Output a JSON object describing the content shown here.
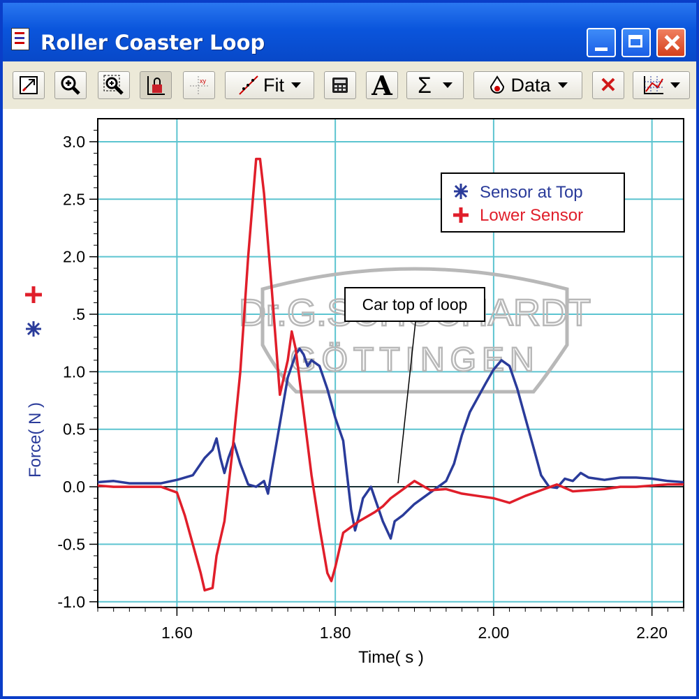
{
  "window": {
    "title": "Roller Coaster Loop"
  },
  "toolbar": {
    "fit_label": "Fit",
    "data_label": "Data",
    "text_tool_glyph": "A",
    "stats_glyph": "Σ",
    "delete_glyph": "✕"
  },
  "colors": {
    "series_top": "#2a3b9a",
    "series_lower": "#e01e2a",
    "grid": "#5cc4d0",
    "watermark": "#b8b8b8"
  },
  "watermark": {
    "line1": "Dr.G.SCHUCHARDT",
    "line2": "GÖTTINGEN"
  },
  "annotation": {
    "text": "Car top of loop"
  },
  "chart_data": {
    "type": "line",
    "title": "",
    "xlabel": "Time( s )",
    "ylabel": "Force( N )",
    "xlim": [
      1.5,
      2.24
    ],
    "ylim": [
      -1.05,
      3.2
    ],
    "x_ticks": [
      "1.60",
      "1.80",
      "2.00",
      "2.20"
    ],
    "x_tick_values": [
      1.6,
      1.8,
      2.0,
      2.2
    ],
    "y_ticks": [
      "-1.0",
      "-0.5",
      "0.0",
      "0.5",
      "1.0",
      ".5",
      "2.0",
      "2.5",
      "3.0"
    ],
    "y_tick_values": [
      -1.0,
      -0.5,
      0.0,
      0.5,
      1.0,
      1.5,
      2.0,
      2.5,
      3.0
    ],
    "grid": true,
    "legend_position": "top-right",
    "series": [
      {
        "name": "Sensor at Top",
        "marker": "asterisk",
        "color": "#2a3b9a",
        "points": [
          [
            1.5,
            0.04
          ],
          [
            1.52,
            0.05
          ],
          [
            1.54,
            0.03
          ],
          [
            1.56,
            0.03
          ],
          [
            1.58,
            0.03
          ],
          [
            1.6,
            0.06
          ],
          [
            1.62,
            0.1
          ],
          [
            1.635,
            0.25
          ],
          [
            1.645,
            0.32
          ],
          [
            1.65,
            0.42
          ],
          [
            1.655,
            0.25
          ],
          [
            1.66,
            0.12
          ],
          [
            1.665,
            0.25
          ],
          [
            1.672,
            0.38
          ],
          [
            1.68,
            0.2
          ],
          [
            1.69,
            0.02
          ],
          [
            1.7,
            0.0
          ],
          [
            1.71,
            0.05
          ],
          [
            1.715,
            -0.06
          ],
          [
            1.72,
            0.15
          ],
          [
            1.73,
            0.55
          ],
          [
            1.74,
            0.95
          ],
          [
            1.75,
            1.15
          ],
          [
            1.755,
            1.2
          ],
          [
            1.76,
            1.15
          ],
          [
            1.765,
            1.05
          ],
          [
            1.77,
            1.1
          ],
          [
            1.78,
            1.05
          ],
          [
            1.79,
            0.85
          ],
          [
            1.8,
            0.6
          ],
          [
            1.81,
            0.4
          ],
          [
            1.815,
            0.1
          ],
          [
            1.82,
            -0.2
          ],
          [
            1.825,
            -0.38
          ],
          [
            1.83,
            -0.25
          ],
          [
            1.835,
            -0.1
          ],
          [
            1.845,
            0.0
          ],
          [
            1.85,
            -0.1
          ],
          [
            1.86,
            -0.3
          ],
          [
            1.87,
            -0.45
          ],
          [
            1.875,
            -0.3
          ],
          [
            1.885,
            -0.25
          ],
          [
            1.9,
            -0.15
          ],
          [
            1.92,
            -0.05
          ],
          [
            1.94,
            0.05
          ],
          [
            1.95,
            0.2
          ],
          [
            1.96,
            0.45
          ],
          [
            1.97,
            0.65
          ],
          [
            1.99,
            0.9
          ],
          [
            2.0,
            1.02
          ],
          [
            2.01,
            1.1
          ],
          [
            2.02,
            1.05
          ],
          [
            2.03,
            0.85
          ],
          [
            2.04,
            0.6
          ],
          [
            2.05,
            0.35
          ],
          [
            2.06,
            0.1
          ],
          [
            2.07,
            0.0
          ],
          [
            2.08,
            -0.01
          ],
          [
            2.09,
            0.07
          ],
          [
            2.1,
            0.05
          ],
          [
            2.11,
            0.12
          ],
          [
            2.12,
            0.08
          ],
          [
            2.14,
            0.06
          ],
          [
            2.16,
            0.08
          ],
          [
            2.18,
            0.08
          ],
          [
            2.2,
            0.07
          ],
          [
            2.22,
            0.05
          ],
          [
            2.24,
            0.04
          ]
        ]
      },
      {
        "name": "Lower Sensor",
        "marker": "cross",
        "color": "#e01e2a",
        "points": [
          [
            1.5,
            0.01
          ],
          [
            1.52,
            0.0
          ],
          [
            1.54,
            0.0
          ],
          [
            1.56,
            0.0
          ],
          [
            1.58,
            0.0
          ],
          [
            1.6,
            -0.05
          ],
          [
            1.61,
            -0.25
          ],
          [
            1.62,
            -0.5
          ],
          [
            1.63,
            -0.75
          ],
          [
            1.635,
            -0.9
          ],
          [
            1.645,
            -0.88
          ],
          [
            1.65,
            -0.6
          ],
          [
            1.66,
            -0.3
          ],
          [
            1.67,
            0.3
          ],
          [
            1.68,
            1.0
          ],
          [
            1.69,
            2.0
          ],
          [
            1.7,
            2.85
          ],
          [
            1.705,
            2.85
          ],
          [
            1.71,
            2.55
          ],
          [
            1.72,
            1.7
          ],
          [
            1.73,
            0.8
          ],
          [
            1.74,
            1.1
          ],
          [
            1.745,
            1.35
          ],
          [
            1.75,
            1.2
          ],
          [
            1.76,
            0.65
          ],
          [
            1.77,
            0.1
          ],
          [
            1.78,
            -0.35
          ],
          [
            1.79,
            -0.75
          ],
          [
            1.795,
            -0.82
          ],
          [
            1.8,
            -0.7
          ],
          [
            1.81,
            -0.4
          ],
          [
            1.83,
            -0.3
          ],
          [
            1.85,
            -0.22
          ],
          [
            1.86,
            -0.17
          ],
          [
            1.87,
            -0.1
          ],
          [
            1.88,
            -0.05
          ],
          [
            1.9,
            0.05
          ],
          [
            1.92,
            -0.03
          ],
          [
            1.94,
            -0.02
          ],
          [
            1.96,
            -0.06
          ],
          [
            1.98,
            -0.08
          ],
          [
            2.0,
            -0.1
          ],
          [
            2.02,
            -0.14
          ],
          [
            2.04,
            -0.08
          ],
          [
            2.06,
            -0.03
          ],
          [
            2.08,
            0.02
          ],
          [
            2.1,
            -0.04
          ],
          [
            2.12,
            -0.03
          ],
          [
            2.14,
            -0.02
          ],
          [
            2.16,
            0.0
          ],
          [
            2.18,
            0.0
          ],
          [
            2.2,
            0.01
          ],
          [
            2.22,
            0.02
          ],
          [
            2.24,
            0.02
          ]
        ]
      }
    ]
  }
}
